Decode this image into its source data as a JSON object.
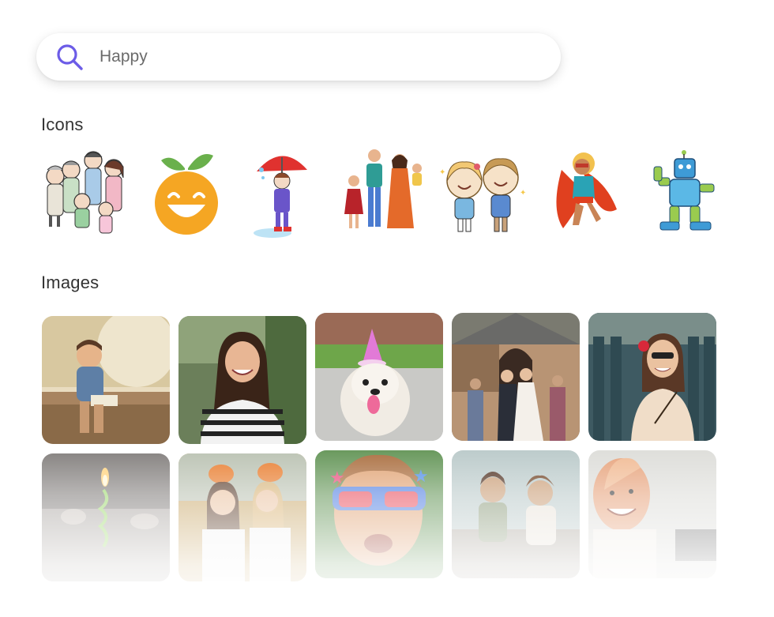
{
  "search": {
    "value": "Happy",
    "placeholder": "Search"
  },
  "sections": {
    "icons_title": "Icons",
    "images_title": "Images"
  },
  "icons": [
    {
      "name": "family-icon"
    },
    {
      "name": "smiling-orange-icon"
    },
    {
      "name": "girl-umbrella-icon"
    },
    {
      "name": "family-with-children-icon"
    },
    {
      "name": "happy-kids-icon"
    },
    {
      "name": "superhero-icon"
    },
    {
      "name": "robot-icon"
    }
  ],
  "images": [
    {
      "name": "boy-laughing-bench"
    },
    {
      "name": "woman-striped-shirt"
    },
    {
      "name": "dog-party-hat"
    },
    {
      "name": "wedding-couple"
    },
    {
      "name": "woman-red-flower"
    },
    {
      "name": "birthday-candle"
    },
    {
      "name": "two-women-pumpkins"
    },
    {
      "name": "boy-star-glasses"
    },
    {
      "name": "friends-laughing"
    },
    {
      "name": "bald-man-smiling"
    }
  ],
  "colors": {
    "accent": "#6c5ce7",
    "text": "#333333",
    "placeholder": "#6b6b6b"
  }
}
